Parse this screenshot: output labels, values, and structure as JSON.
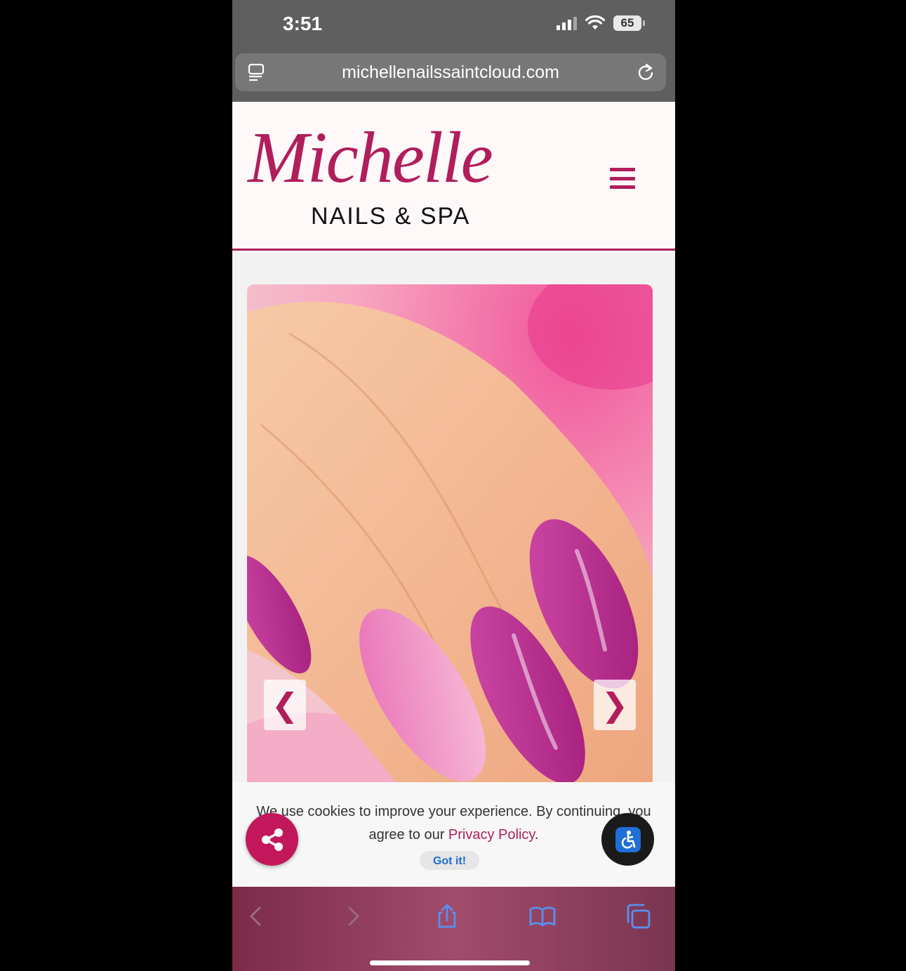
{
  "status_bar": {
    "time": "3:51",
    "battery": "65"
  },
  "browser": {
    "url": "michellenailssaintcloud.com"
  },
  "site": {
    "logo_script": "Michelle",
    "logo_sub": "NAILS & SPA"
  },
  "slider": {
    "prev_label": "❮",
    "next_label": "❯"
  },
  "cookie": {
    "text_before": "We use cookies to improve your experience. By continuing, you agree to our ",
    "link_label": "Privacy Policy",
    "text_after": ".",
    "button_label": "Got it!"
  },
  "colors": {
    "brand": "#b01e5c",
    "share_button": "#c2185b",
    "link_blue": "#1c6fd1"
  },
  "icons": {
    "share": "share-icon",
    "accessibility": "accessibility-icon",
    "menu": "hamburger-menu-icon"
  }
}
